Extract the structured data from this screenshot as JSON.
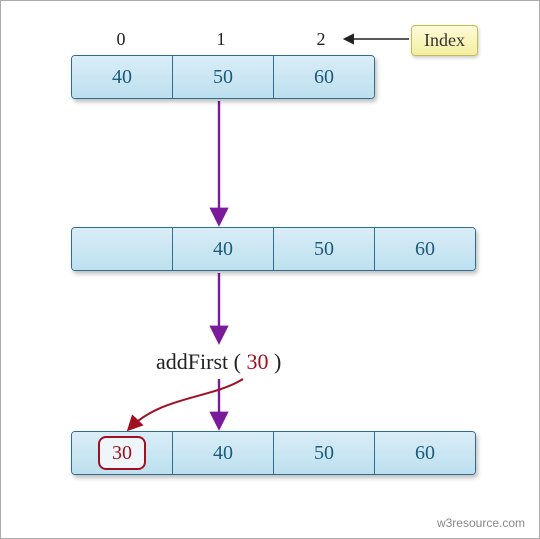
{
  "indices": [
    "0",
    "1",
    "2"
  ],
  "index_badge": "Index",
  "array1": [
    "40",
    "50",
    "60"
  ],
  "array2_empty": "",
  "array2": [
    "40",
    "50",
    "60"
  ],
  "method": {
    "name": "addFirst",
    "open": " ( ",
    "arg": "30",
    "close": " )"
  },
  "array3_new": "30",
  "array3": [
    "40",
    "50",
    "60"
  ],
  "footer": "w3resource.com",
  "colors": {
    "cell_bg_top": "#d9edf7",
    "cell_bg_bottom": "#bde0ef",
    "cell_border": "#2f6e8f",
    "cell_text": "#1d5b7a",
    "arrow": "#7b1a9b",
    "new_value": "#a01020",
    "badge_top": "#fdfbd9",
    "badge_bottom": "#f4eea0"
  }
}
